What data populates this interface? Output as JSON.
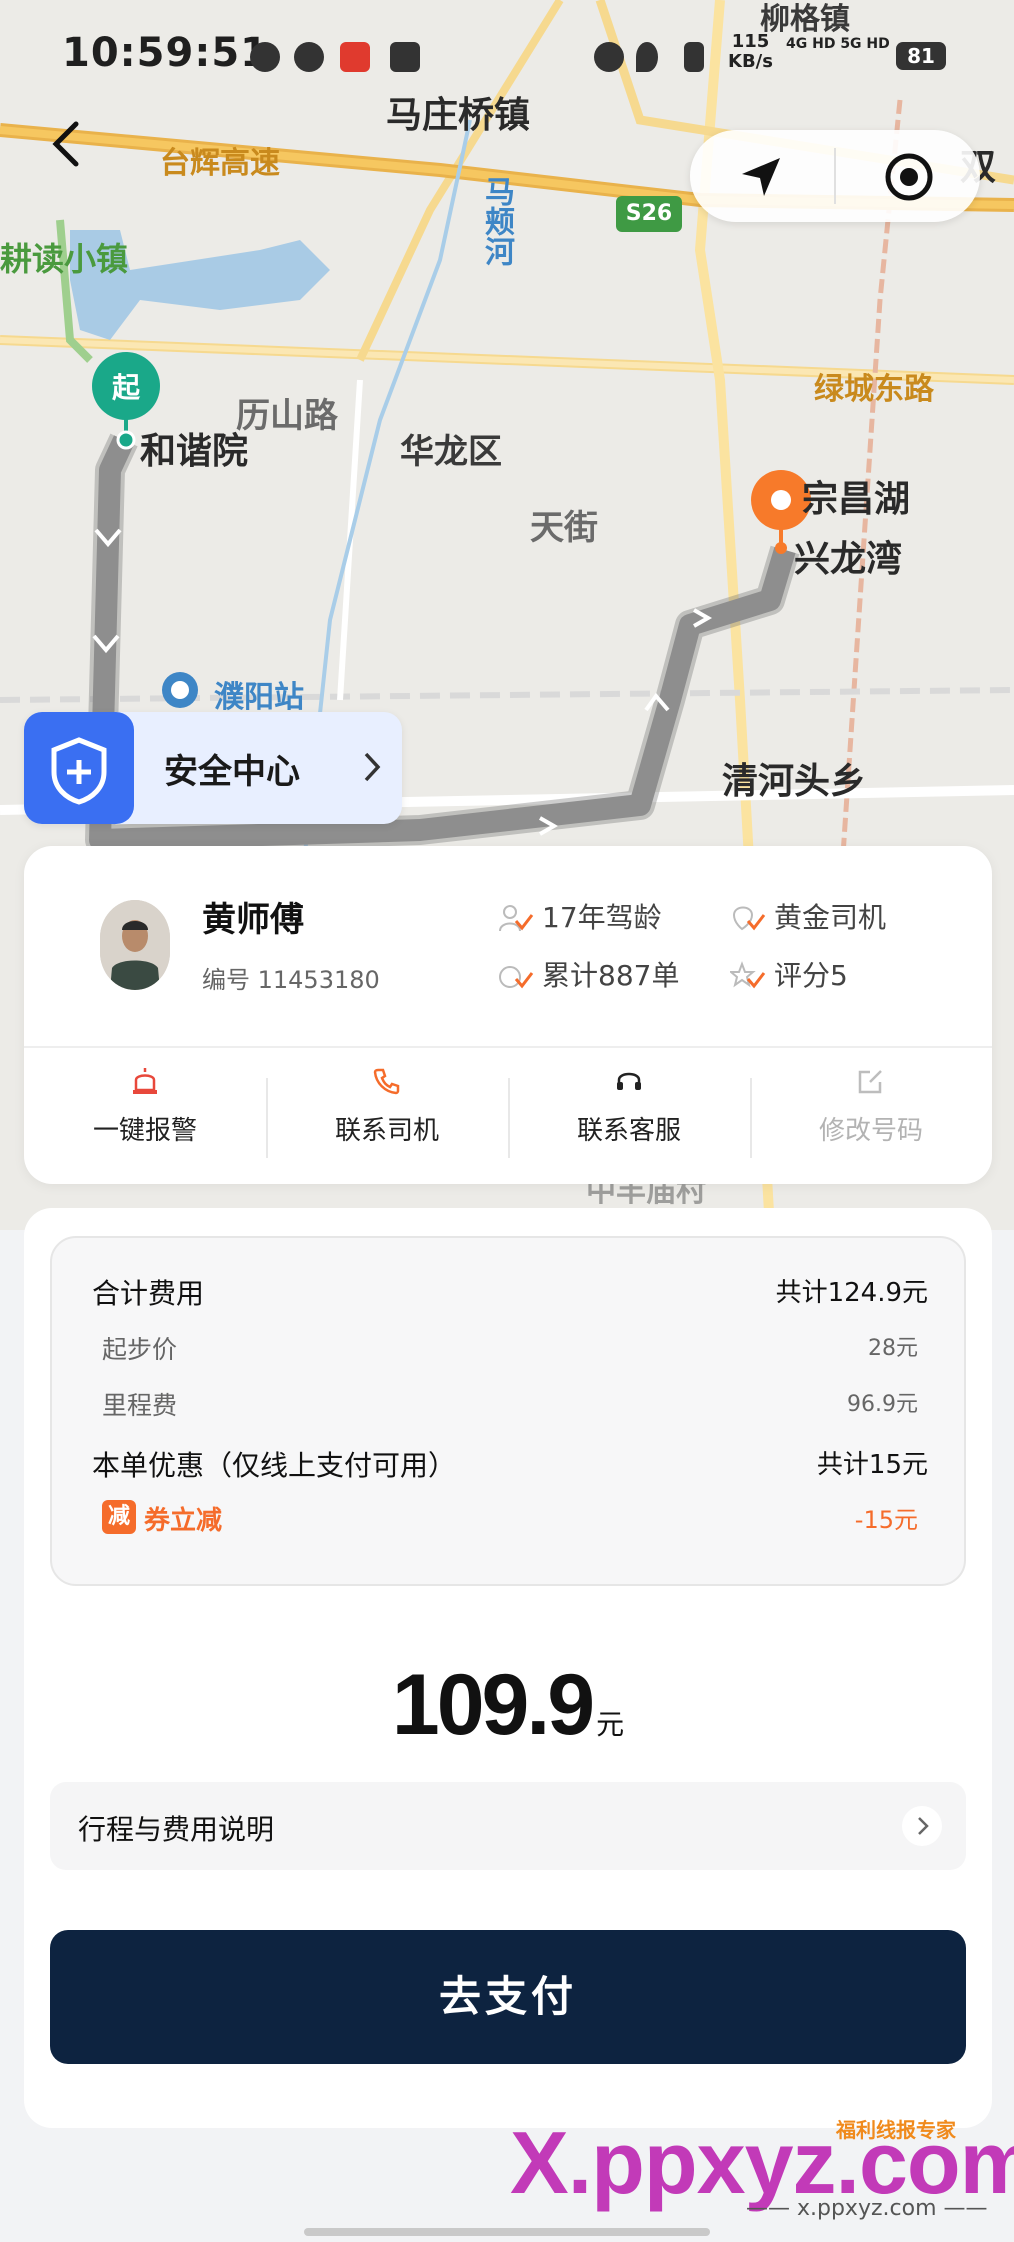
{
  "status_bar": {
    "time": "10:59:51",
    "speed_value": "115",
    "speed_unit": "KB/s",
    "network": "4G HD 5G HD",
    "battery": "81"
  },
  "map": {
    "labels": {
      "town_mazhuangqiao": "马庄桥镇",
      "town_liugu": "柳格镇",
      "highway_taihui": "台辉高速",
      "river_mapo": "马颊河",
      "highway_s26": "S26",
      "town_gengdu": "耕读小镇",
      "road_lishan": "历山路",
      "road_lvcheng_east": "绿城东路",
      "district_hualong": "华龙区",
      "area_tianjie": "天街",
      "poi_hexieyuan": "和谐院",
      "poi_zongchanghu": "宗昌湖",
      "poi_xinglongwan": "兴龙湾",
      "station_puyang": "濮阳站",
      "town_qinghetou": "清河头乡",
      "village_zhongfeng": "中丰庙村",
      "edge_shuang": "双"
    },
    "start_marker": "起",
    "controls": [
      "navigate-icon",
      "locate-icon"
    ]
  },
  "safety_center": {
    "label": "安全中心"
  },
  "driver": {
    "name": "黄师傅",
    "id_text": "编号 11453180",
    "stats": {
      "driving_years": "17年驾龄",
      "level": "黄金司机",
      "orders": "累计887单",
      "rating": "评分5"
    },
    "actions": {
      "sos": "一键报警",
      "contact_driver": "联系司机",
      "contact_service": "联系客服",
      "change_number": "修改号码"
    }
  },
  "fees": {
    "total_label": "合计费用",
    "total_value": "共计124.9元",
    "base_label": "起步价",
    "base_value": "28元",
    "mileage_label": "里程费",
    "mileage_value": "96.9元",
    "discount_label": "本单优惠（仅线上支付可用）",
    "discount_value": "共计15元",
    "coupon_badge": "减",
    "coupon_label": "券立减",
    "coupon_value": "-15元"
  },
  "payment": {
    "amount": "109.9",
    "unit": "元",
    "explain_label": "行程与费用说明",
    "pay_button": "去支付"
  },
  "watermark": {
    "main": "X.ppxyz.com",
    "top": "福利线报专家",
    "sub": "—— x.ppxyz.com ——"
  },
  "colors": {
    "route": "#8e8e8e",
    "start_marker": "#1aa889",
    "end_marker": "#f77a2a",
    "pay_button": "#0d2340",
    "accent_orange": "#f56c2b",
    "safety_blue": "#3a6ff2"
  }
}
